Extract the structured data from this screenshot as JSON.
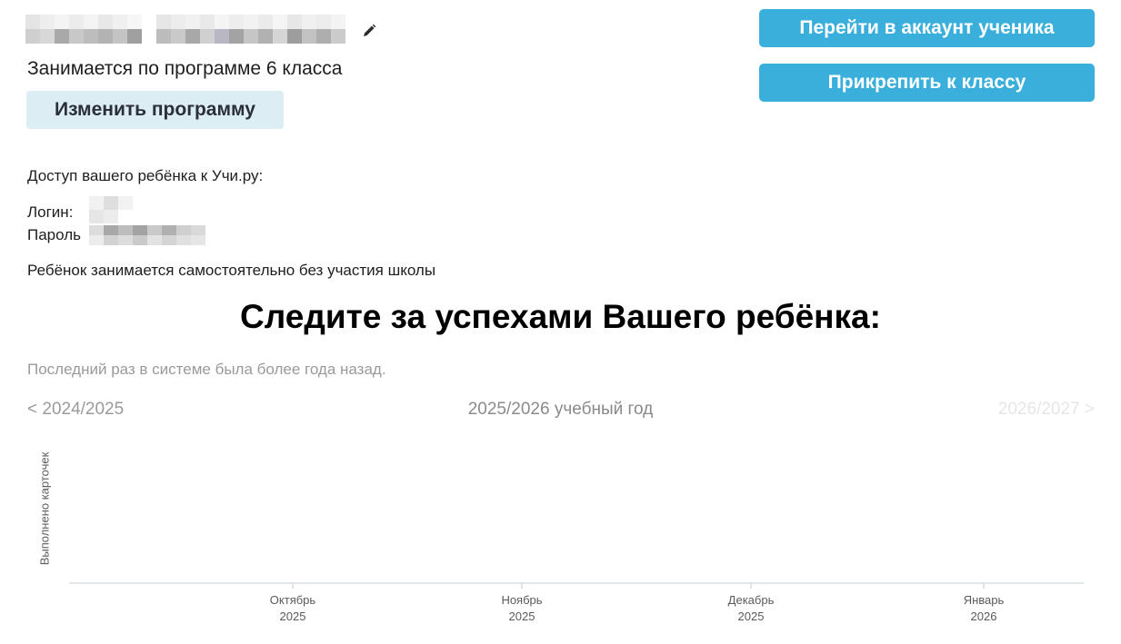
{
  "profile": {
    "program_text": "Занимается по программе 6 класса",
    "change_program_label": "Изменить программу"
  },
  "actions": {
    "go_to_student_label": "Перейти в аккаунт ученика",
    "attach_to_class_label": "Прикрепить к классу"
  },
  "access": {
    "title": "Доступ вашего ребёнка к Учи.ру:",
    "login_label": "Логин: ",
    "password_label": "Пароль"
  },
  "status": {
    "self_study": "Ребёнок занимается самостоятельно без участия школы"
  },
  "progress": {
    "heading": "Следите за успехами Вашего ребёнка:",
    "last_seen": "Последний раз в системе была более года назад.",
    "year_nav": {
      "prev": "< 2024/2025",
      "current": "2025/2026 учебный год",
      "next": "2026/2027 >"
    }
  },
  "colors": {
    "primary_button": "#3aafdc",
    "secondary_button": "#dcedf3",
    "axis": "#d5dde6",
    "muted_text": "#9a9a9a"
  },
  "chart_data": {
    "type": "bar",
    "ylabel": "Выполнено карточек",
    "xlabel": "",
    "categories": [
      {
        "month": "Октябрь",
        "year": "2025"
      },
      {
        "month": "Ноябрь",
        "year": "2025"
      },
      {
        "month": "Декабрь",
        "year": "2025"
      },
      {
        "month": "Январь",
        "year": "2026"
      }
    ],
    "values": [],
    "grid": false
  }
}
